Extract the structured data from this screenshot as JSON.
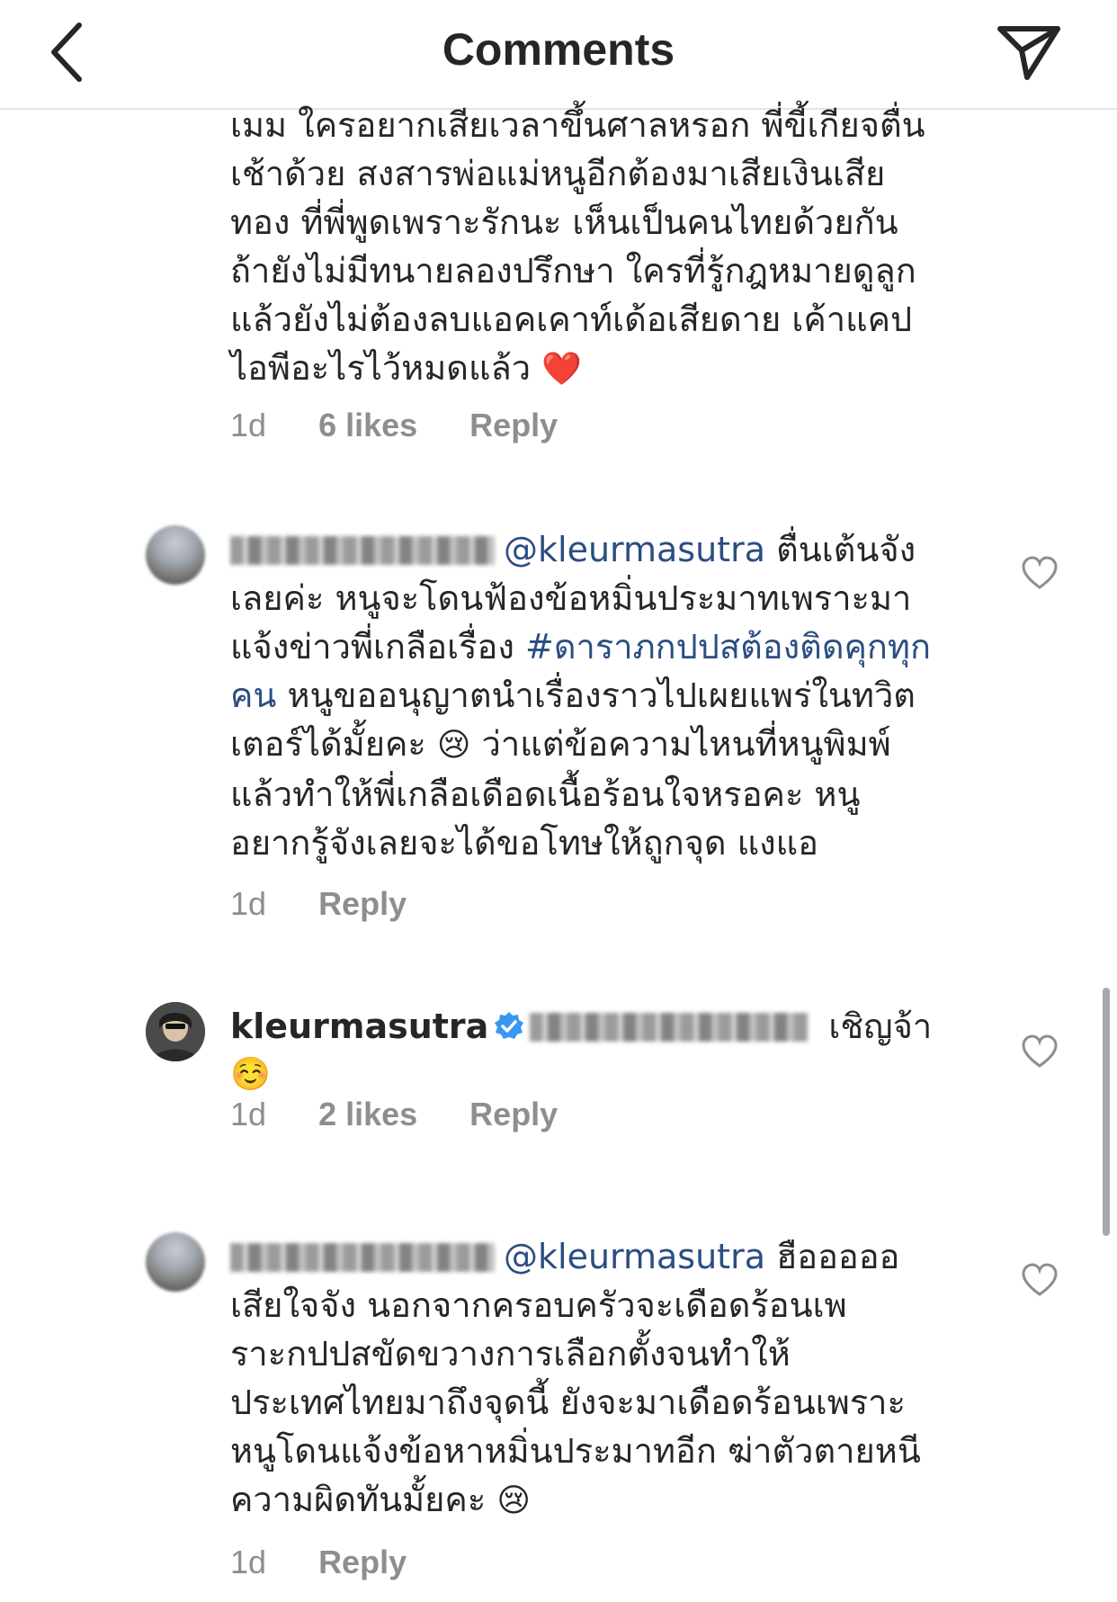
{
  "header": {
    "title": "Comments",
    "back_icon": "chevron-left-icon",
    "share_icon": "paper-plane-icon"
  },
  "comments": [
    {
      "id": "c1",
      "lines": [
        "เมม ใครอยากเสียเวลาขึ้นศาลหรอก พี่ขี้เกียจตื่น",
        "เช้าด้วย สงสารพ่อแม่หนูอีกต้องมาเสียเงินเสีย",
        "ทอง ที่พี่พูดเพราะรักนะ เห็นเป็นคนไทยด้วยกัน",
        "ถ้ายังไม่มีทนายลองปรึกษา ใครที่รู้กฎหมายดูลูก",
        "แล้วยังไม่ต้องลบแอคเคาท์เด้อเสียดาย เค้าแคป",
        "ไอพีอะไรไว้หมดแล้ว"
      ],
      "emoji": "❤️",
      "time": "1d",
      "likes": "6 likes",
      "reply": "Reply"
    },
    {
      "id": "c2",
      "username_blurred": true,
      "mention": "@kleurmasutra",
      "line1_rest": " ตื่นเต้นจัง",
      "lines": [
        "เลยค่ะ หนูจะโดนฟ้องข้อหมิ่นประมาทเพราะมา"
      ],
      "line3_plain": "แจ้งข่าวพี่เกลือเรื่อง ",
      "hashtag_part1": "#ดาราภกปปสต้องติดคุกทุก",
      "hashtag_part2": "คน",
      "line4_rest": " หนูขออนุญาตนำเรื่องราวไปเผยแพร่ในทวิต",
      "line5_a": "เตอร์ได้มั้ยคะ ",
      "emoji": "😢",
      "line5_b": " ว่าแต่ข้อความไหนที่หนูพิมพ์",
      "lines_tail": [
        "แล้วทำให้พี่เกลือเดือดเนื้อร้อนใจหรอคะ หนู",
        "อยากรู้จังเลยจะได้ขอโทษให้ถูกจุด แงแอ"
      ],
      "time": "1d",
      "reply": "Reply"
    },
    {
      "id": "c3",
      "username": "kleurmasutra",
      "text": " เชิญจ้า",
      "emoji": "☺️",
      "time": "1d",
      "likes": "2 likes",
      "reply": "Reply"
    },
    {
      "id": "c4",
      "username_blurred": true,
      "mention": "@kleurmasutra",
      "line1_rest": " ฮือออออ",
      "lines": [
        "เสียใจจัง นอกจากครอบครัวจะเดือดร้อนเพ",
        "ราะกปปสขัดขวางการเลือกตั้งจนทำให้",
        "ประเทศไทยมาถึงจุดนี้ ยังจะมาเดือดร้อนเพราะ",
        "หนูโดนแจ้งข้อหาหมิ่นประมาทอีก ฆ่าตัวตายหนี"
      ],
      "last_line": "ความผิดทันมั้ยคะ ",
      "emoji": "😢",
      "time": "1d",
      "reply": "Reply"
    }
  ],
  "colors": {
    "mention": "#2b4d82",
    "meta": "#8e8e8e",
    "text": "#262626",
    "verified": "#3897f0"
  }
}
